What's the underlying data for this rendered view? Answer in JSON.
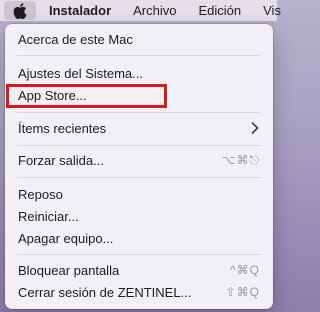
{
  "menubar": {
    "apple_icon": "apple-logo-icon",
    "items": [
      "Instalador",
      "Archivo",
      "Edición",
      "Vis"
    ]
  },
  "menu": {
    "items": {
      "about": "Acerca de este Mac",
      "system_settings": "Ajustes del Sistema...",
      "app_store": "App Store...",
      "recent_items": "Ítems recientes",
      "force_quit": "Forzar salida...",
      "force_quit_shortcut": "⌥⌘⎋",
      "sleep": "Reposo",
      "restart": "Reiniciar...",
      "shut_down": "Apagar equipo...",
      "lock_screen": "Bloquear pantalla",
      "lock_screen_shortcut": "^⌘Q",
      "log_out": "Cerrar sesión de ZENTINEL...",
      "log_out_shortcut": "⇧⌘Q"
    },
    "submenu_icon": "chevron-right-icon",
    "highlight_color": "#e0141e"
  }
}
